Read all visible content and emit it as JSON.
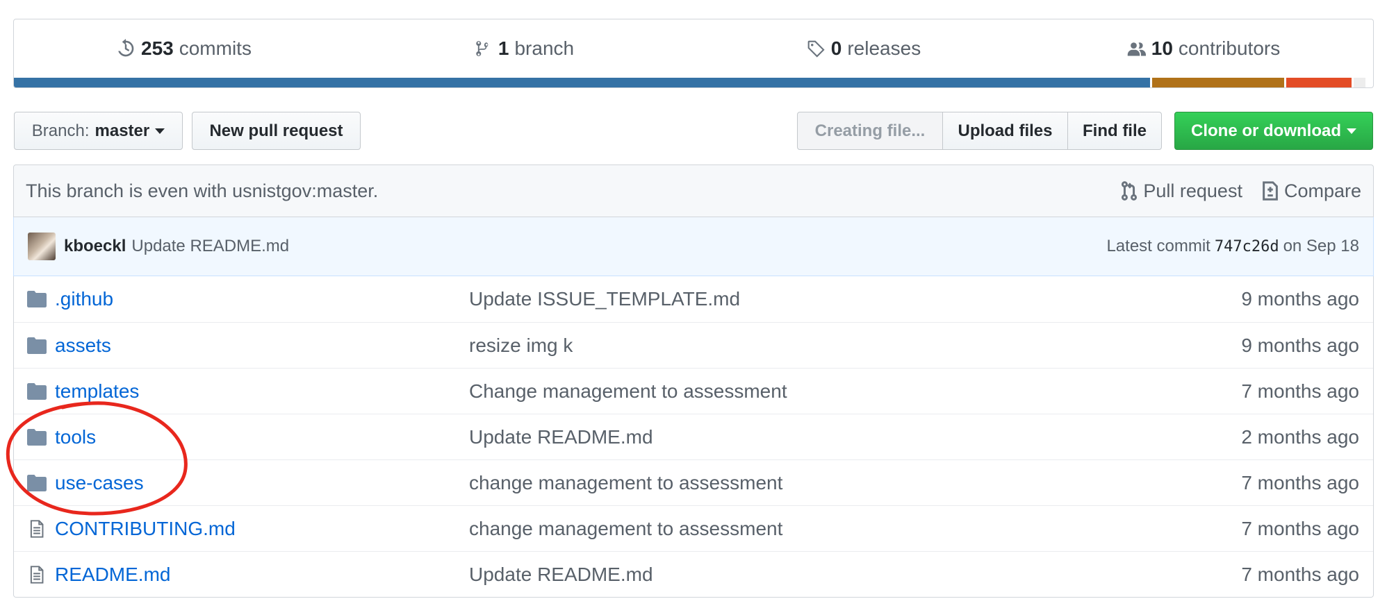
{
  "summary": {
    "commits": {
      "count": "253",
      "label": "commits"
    },
    "branches": {
      "count": "1",
      "label": "branch"
    },
    "releases": {
      "count": "0",
      "label": "releases"
    },
    "contributors": {
      "count": "10",
      "label": "contributors"
    }
  },
  "language_bar": [
    {
      "color": "#3572A5",
      "fraction": 0.836
    },
    {
      "color": "#b07219",
      "fraction": 0.097
    },
    {
      "color": "#e34c26",
      "fraction": 0.048
    },
    {
      "color": "#ededed",
      "fraction": 0.009
    }
  ],
  "toolbar": {
    "branch_prefix": "Branch:",
    "branch_name": "master",
    "new_pr_label": "New pull request",
    "creating_file_label": "Creating file...",
    "upload_label": "Upload files",
    "find_label": "Find file",
    "clone_label": "Clone or download"
  },
  "infobar": {
    "status": "This branch is even with usnistgov:master.",
    "pull_request_label": "Pull request",
    "compare_label": "Compare"
  },
  "commit": {
    "author": "kboeckl",
    "message": "Update README.md",
    "latest_prefix": "Latest commit",
    "sha": "747c26d",
    "date": "on Sep 18"
  },
  "files": [
    {
      "type": "dir",
      "name": ".github",
      "message": "Update ISSUE_TEMPLATE.md",
      "age": "9 months ago"
    },
    {
      "type": "dir",
      "name": "assets",
      "message": "resize img k",
      "age": "9 months ago"
    },
    {
      "type": "dir",
      "name": "templates",
      "message": "Change management to assessment",
      "age": "7 months ago"
    },
    {
      "type": "dir",
      "name": "tools",
      "message": "Update README.md",
      "age": "2 months ago"
    },
    {
      "type": "dir",
      "name": "use-cases",
      "message": "change management to assessment",
      "age": "7 months ago"
    },
    {
      "type": "file",
      "name": "CONTRIBUTING.md",
      "message": "change management to assessment",
      "age": "7 months ago"
    },
    {
      "type": "file",
      "name": "README.md",
      "message": "Update README.md",
      "age": "7 months ago"
    }
  ],
  "colors": {
    "link": "#0366d6",
    "annotation": "#e8271d",
    "clone_button": "#2ea44f"
  }
}
